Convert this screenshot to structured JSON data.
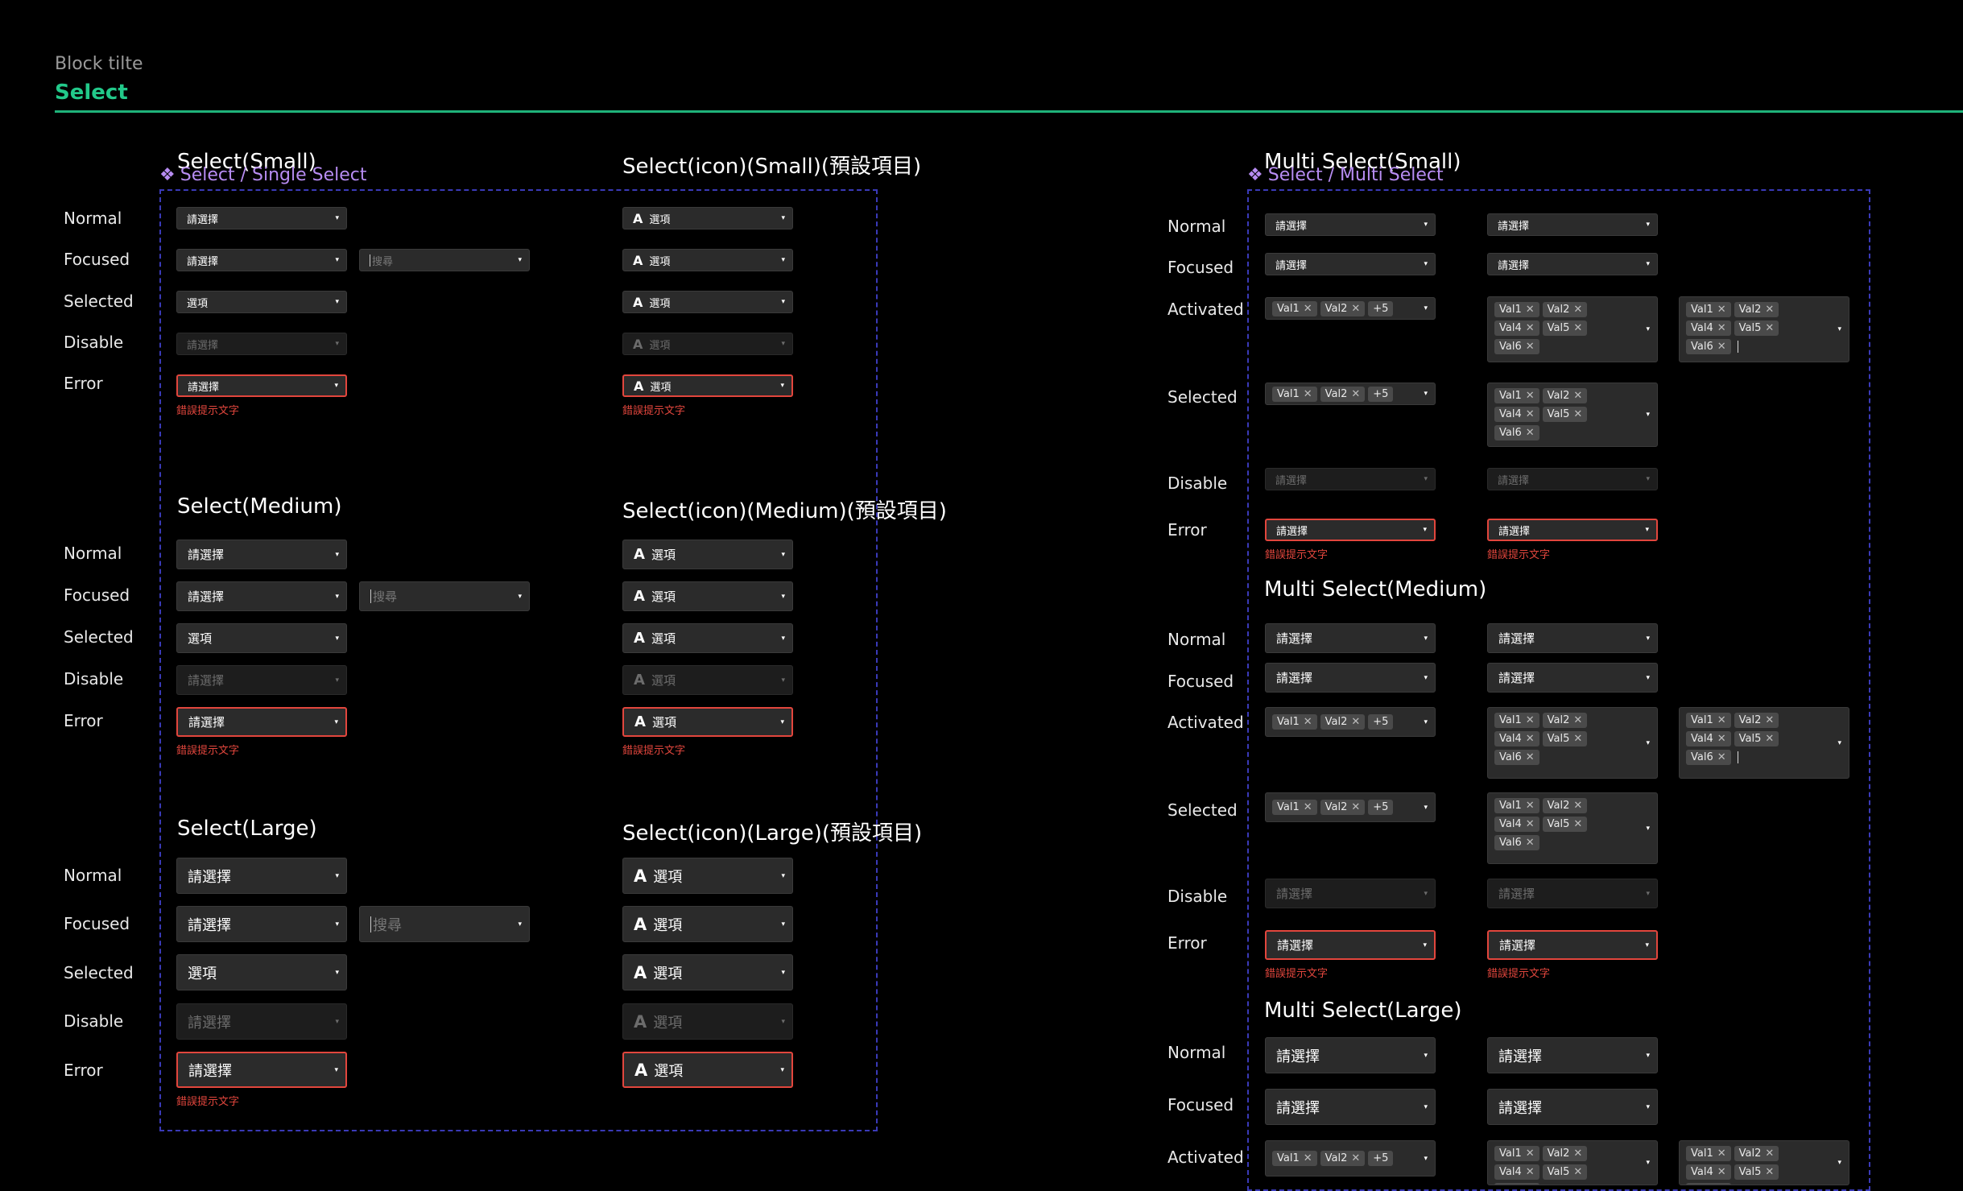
{
  "header": {
    "block_title": "Block tilte",
    "title": "Select"
  },
  "frames": {
    "single": "Select / Single Select",
    "multi": "Select / Multi Select"
  },
  "sections": {
    "s_small": "Select(Small)",
    "s_medium": "Select(Medium)",
    "s_large": "Select(Large)",
    "i_small": "Select(icon)(Small)(預設項目)",
    "i_medium": "Select(icon)(Medium)(預設項目)",
    "i_large": "Select(icon)(Large)(預設項目)",
    "m_small": "Multi Select(Small)",
    "m_medium": "Multi Select(Medium)",
    "m_large": "Multi Select(Large)"
  },
  "states": {
    "normal": "Normal",
    "focused": "Focused",
    "selected": "Selected",
    "disable": "Disable",
    "error": "Error",
    "activated": "Activated"
  },
  "text": {
    "placeholder": "請選擇",
    "option": "選項",
    "search": "搜尋",
    "error_hint": "錯誤提示文字",
    "icon_glyph": "A"
  },
  "tags": {
    "v1": "Val1",
    "v2": "Val2",
    "v4": "Val4",
    "v5": "Val5",
    "v6": "Val6",
    "more": "+5",
    "remove": "✕"
  },
  "icons": {
    "arrow": "▾",
    "frame": "❖"
  },
  "colors": {
    "accent": "#22c98a",
    "error": "#e2463d",
    "frame": "#3a3ab8",
    "frame_label": "#b78cf2"
  }
}
